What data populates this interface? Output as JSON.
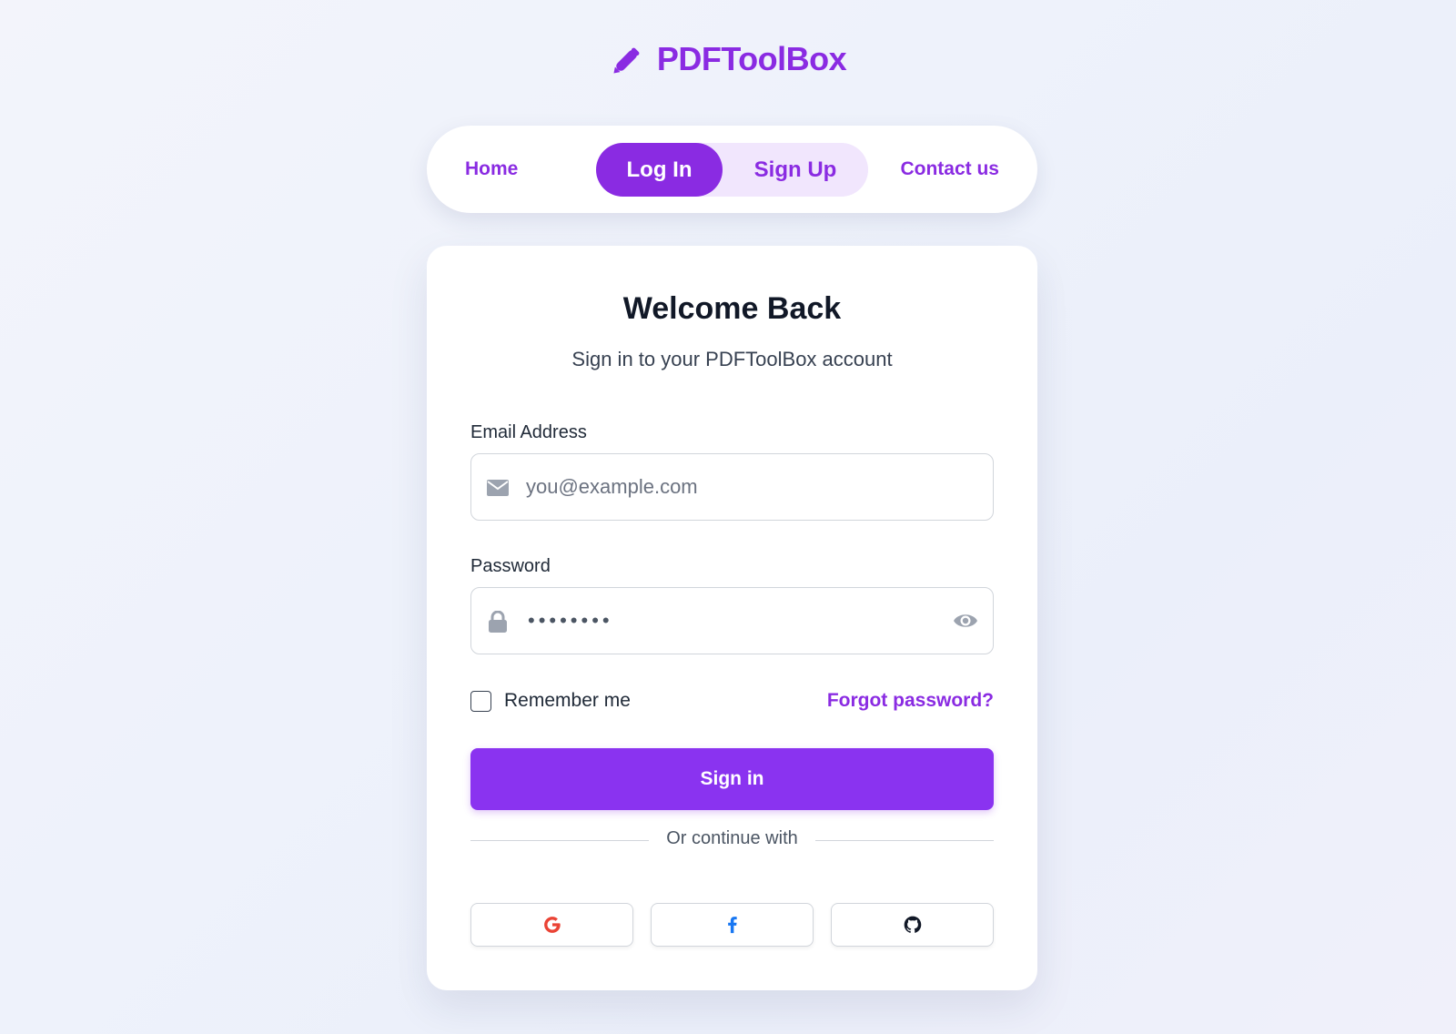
{
  "brand": {
    "name": "PDFToolBox",
    "icon": "pencil-icon",
    "color": "#8a2be2"
  },
  "nav": {
    "home": "Home",
    "login": "Log In",
    "signup": "Sign Up",
    "contact": "Contact us",
    "active_tab": "Log In"
  },
  "card": {
    "title": "Welcome Back",
    "subtitle": "Sign in to your PDFToolBox account"
  },
  "form": {
    "email": {
      "label": "Email Address",
      "placeholder": "you@example.com",
      "value": "",
      "icon": "envelope-icon"
    },
    "password": {
      "label": "Password",
      "masked_value": "••••••••",
      "icon": "lock-icon",
      "toggle_icon": "eye-icon"
    },
    "remember_label": "Remember me",
    "remember_checked": false,
    "forgot_label": "Forgot password?",
    "submit_label": "Sign in"
  },
  "social": {
    "divider_text": "Or continue with",
    "providers": [
      {
        "name": "Google",
        "icon": "google-icon",
        "color": "#ea4335"
      },
      {
        "name": "Facebook",
        "icon": "facebook-icon",
        "color": "#1877f2"
      },
      {
        "name": "GitHub",
        "icon": "github-icon",
        "color": "#111827"
      }
    ]
  },
  "colors": {
    "accent": "#8a2be2",
    "button": "#8a33f0",
    "toggle_bg": "#f1e6fd"
  }
}
